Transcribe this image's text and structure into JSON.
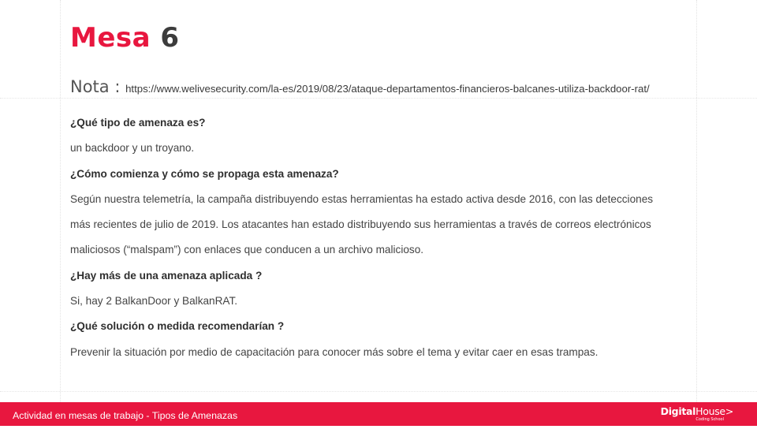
{
  "slide": {
    "title_word": "Mesa",
    "title_number": "6",
    "nota_label": "Nota : ",
    "nota_url": "https://www.welivesecurity.com/la-es/2019/08/23/ataque-departamentos-financieros-balcanes-utiliza-backdoor-rat/",
    "q1": "¿Qué tipo de amenaza es?",
    "a1": "un backdoor y un troyano.",
    "q2": "¿Cómo comienza y cómo se propaga esta amenaza?",
    "a2_line1": "Según nuestra telemetría, la campaña distribuyendo estas herramientas ha estado activa desde 2016, con las detecciones",
    "a2_line2": "más recientes de julio de 2019. Los atacantes han estado distribuyendo sus herramientas a través de correos electrónicos",
    "a2_line3": "maliciosos (“malspam”) con enlaces que conducen a un archivo malicioso.",
    "q3": "¿Hay más de una amenaza aplicada ?",
    "a3": "Si, hay 2 BalkanDoor y BalkanRAT.",
    "q4": "¿Qué solución o medida recomendarían ?",
    "a4": "Prevenir la situación por medio de capacitación para conocer más sobre el tema y evitar caer en esas trampas."
  },
  "footer": {
    "text": "Actividad en mesas de trabajo - Tipos de Amenazas",
    "logo_bold": "Digital",
    "logo_light": "House",
    "logo_arrow": ">",
    "logo_sub": "Coding School"
  },
  "colors": {
    "accent": "#e8173f",
    "text": "#3a3a3a"
  }
}
